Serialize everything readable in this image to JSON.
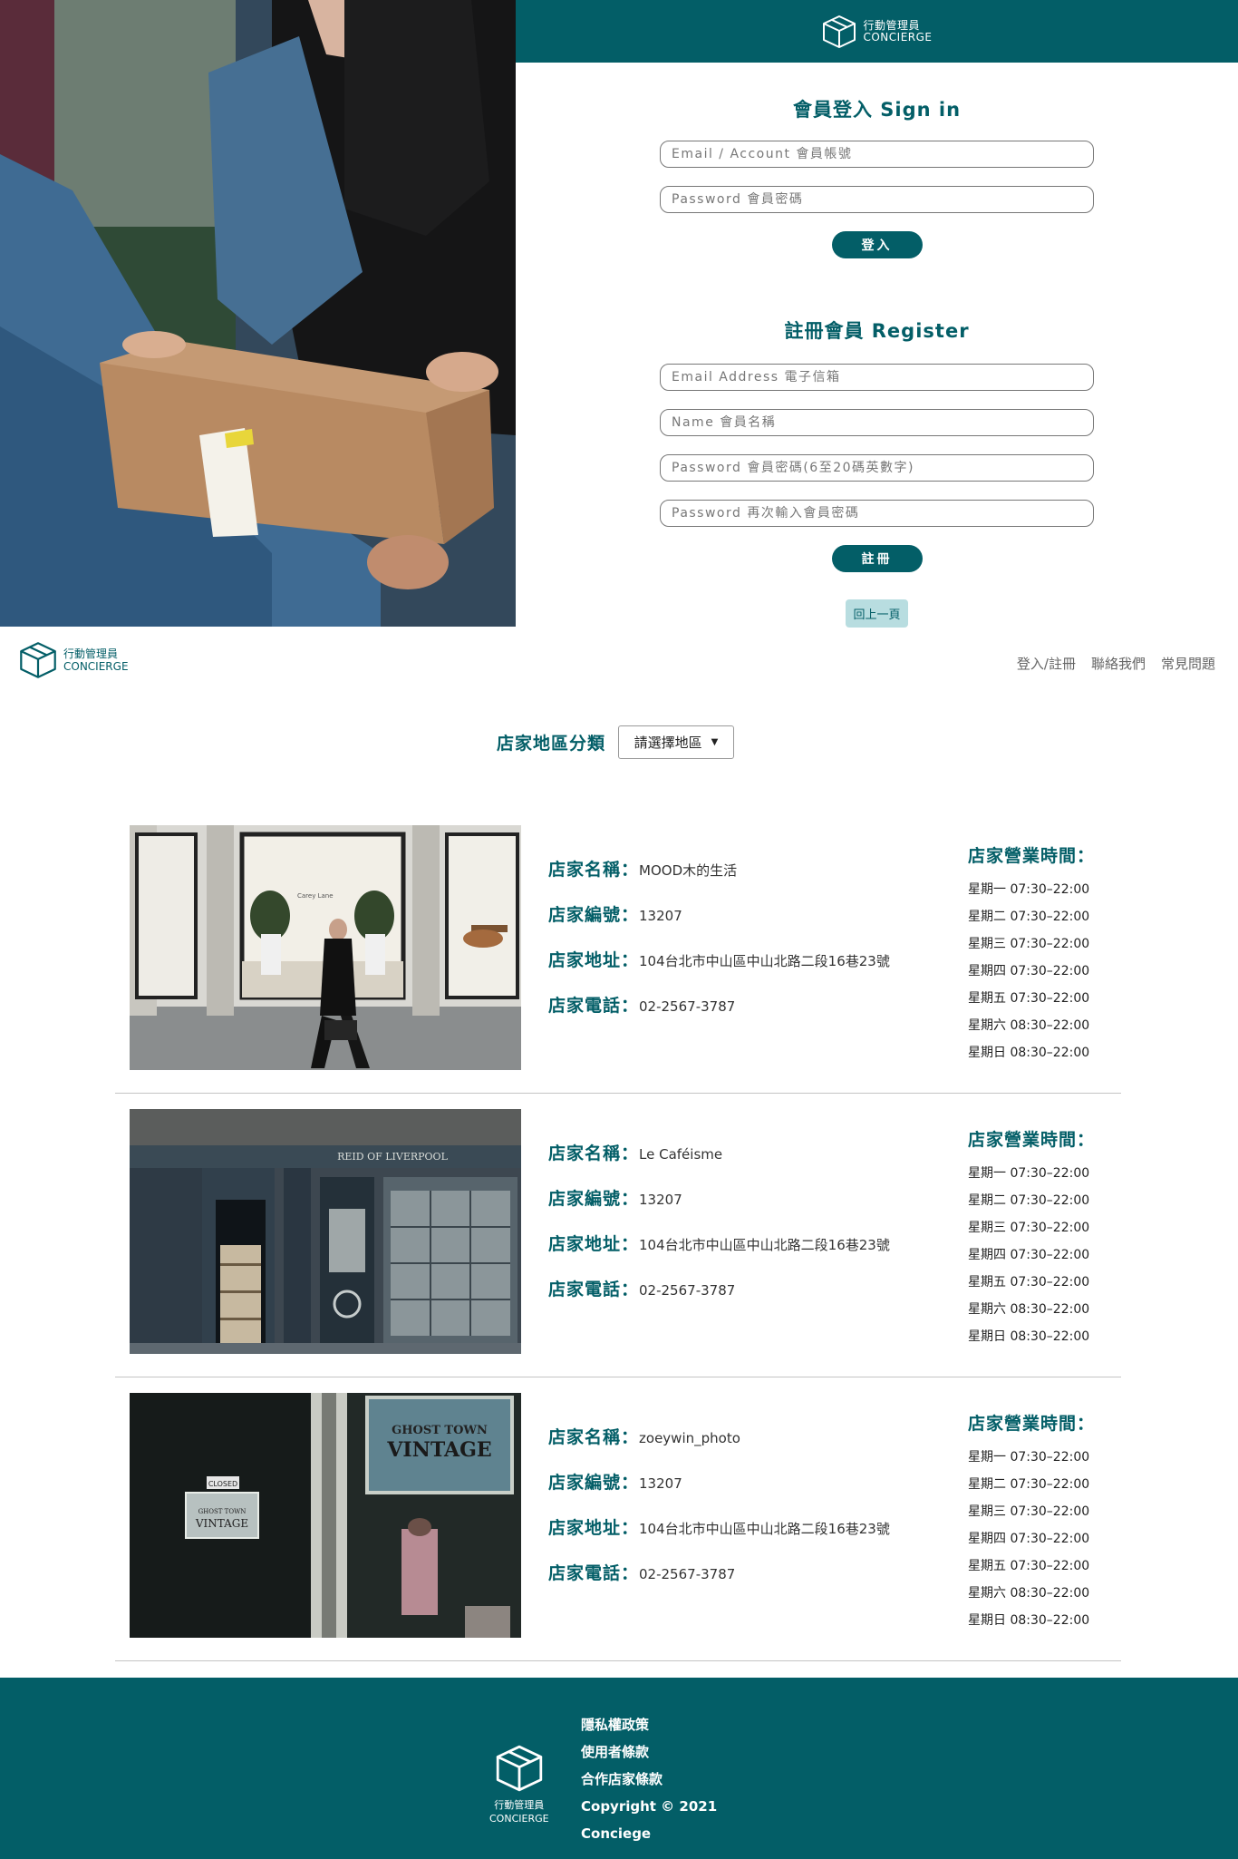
{
  "brand": {
    "name_zh": "行動管理員",
    "name_en": "CONCIERGE"
  },
  "auth": {
    "signin_title": "會員登入 Sign in",
    "signin_fields": [
      {
        "placeholder": "Email / Account 會員帳號"
      },
      {
        "placeholder": "Password 會員密碼"
      }
    ],
    "signin_button": "登入",
    "register_title": "註冊會員 Register",
    "register_fields": [
      {
        "placeholder": "Email Address 電子信箱"
      },
      {
        "placeholder": "Name 會員名稱"
      },
      {
        "placeholder": "Password 會員密碼(6至20碼英數字)"
      },
      {
        "placeholder": "Password 再次輸入會員密碼"
      }
    ],
    "register_button": "註冊",
    "back_button": "回上一頁"
  },
  "nav": [
    "登入/註冊",
    "聯絡我們",
    "常見問題"
  ],
  "filter": {
    "label": "店家地區分類",
    "selected": "請選擇地區"
  },
  "labels": {
    "name": "店家名稱：",
    "id": "店家編號：",
    "address": "店家地址：",
    "phone": "店家電話：",
    "hours": "店家營業時間："
  },
  "stores": [
    {
      "name": "MOOD木的生活",
      "id": "13207",
      "address": "104台北市中山區中山北路二段16巷23號",
      "phone": "02-2567-3787",
      "hours": [
        "星期一 07:30–22:00",
        "星期二 07:30–22:00",
        "星期三 07:30–22:00",
        "星期四 07:30–22:00",
        "星期五 07:30–22:00",
        "星期六 08:30–22:00",
        "星期日 08:30–22:00"
      ],
      "photo_text": "Carey Lane"
    },
    {
      "name": "Le Caféisme",
      "id": "13207",
      "address": "104台北市中山區中山北路二段16巷23號",
      "phone": "02-2567-3787",
      "hours": [
        "星期一 07:30–22:00",
        "星期二 07:30–22:00",
        "星期三 07:30–22:00",
        "星期四 07:30–22:00",
        "星期五 07:30–22:00",
        "星期六 08:30–22:00",
        "星期日 08:30–22:00"
      ],
      "photo_text": "REID OF LIVERPOOL"
    },
    {
      "name": "zoeywin_photo",
      "id": "13207",
      "address": "104台北市中山區中山北路二段16巷23號",
      "phone": "02-2567-3787",
      "hours": [
        "星期一 07:30–22:00",
        "星期二 07:30–22:00",
        "星期三 07:30–22:00",
        "星期四 07:30–22:00",
        "星期五 07:30–22:00",
        "星期六 08:30–22:00",
        "星期日 08:30–22:00"
      ],
      "photo_text": [
        "GHOST TOWN",
        "VINTAGE",
        "CLOSED"
      ]
    }
  ],
  "footer": {
    "links": [
      "隱私權政策",
      "使用者條款",
      "合作店家條款",
      "Copyright © 2021",
      "Conciege"
    ]
  }
}
